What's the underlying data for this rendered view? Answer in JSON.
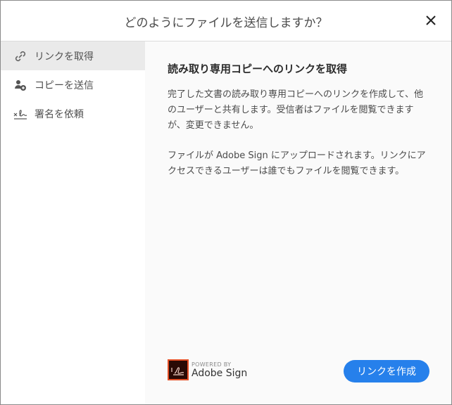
{
  "dialog": {
    "title": "どのようにファイルを送信しますか？"
  },
  "sidebar": {
    "items": [
      {
        "label": "リンクを取得",
        "icon": "link-icon"
      },
      {
        "label": "コピーを送信",
        "icon": "add-user-icon"
      },
      {
        "label": "署名を依頼",
        "icon": "signature-icon"
      }
    ]
  },
  "main": {
    "heading": "読み取り専用コピーへのリンクを取得",
    "para1": "完了した文書の読み取り専用コピーへのリンクを作成して、他のユーザーと共有します。受信者はファイルを閲覧できますが、変更できません。",
    "para2": "ファイルが Adobe Sign にアップロードされます。リンクにアクセスできるユーザーは誰でもファイルを閲覧できます。",
    "powered_by": "POWERED BY",
    "brand": "Adobe Sign",
    "create_button": "リンクを作成"
  },
  "colors": {
    "accent": "#2680eb",
    "selected": "#eaeaea"
  }
}
